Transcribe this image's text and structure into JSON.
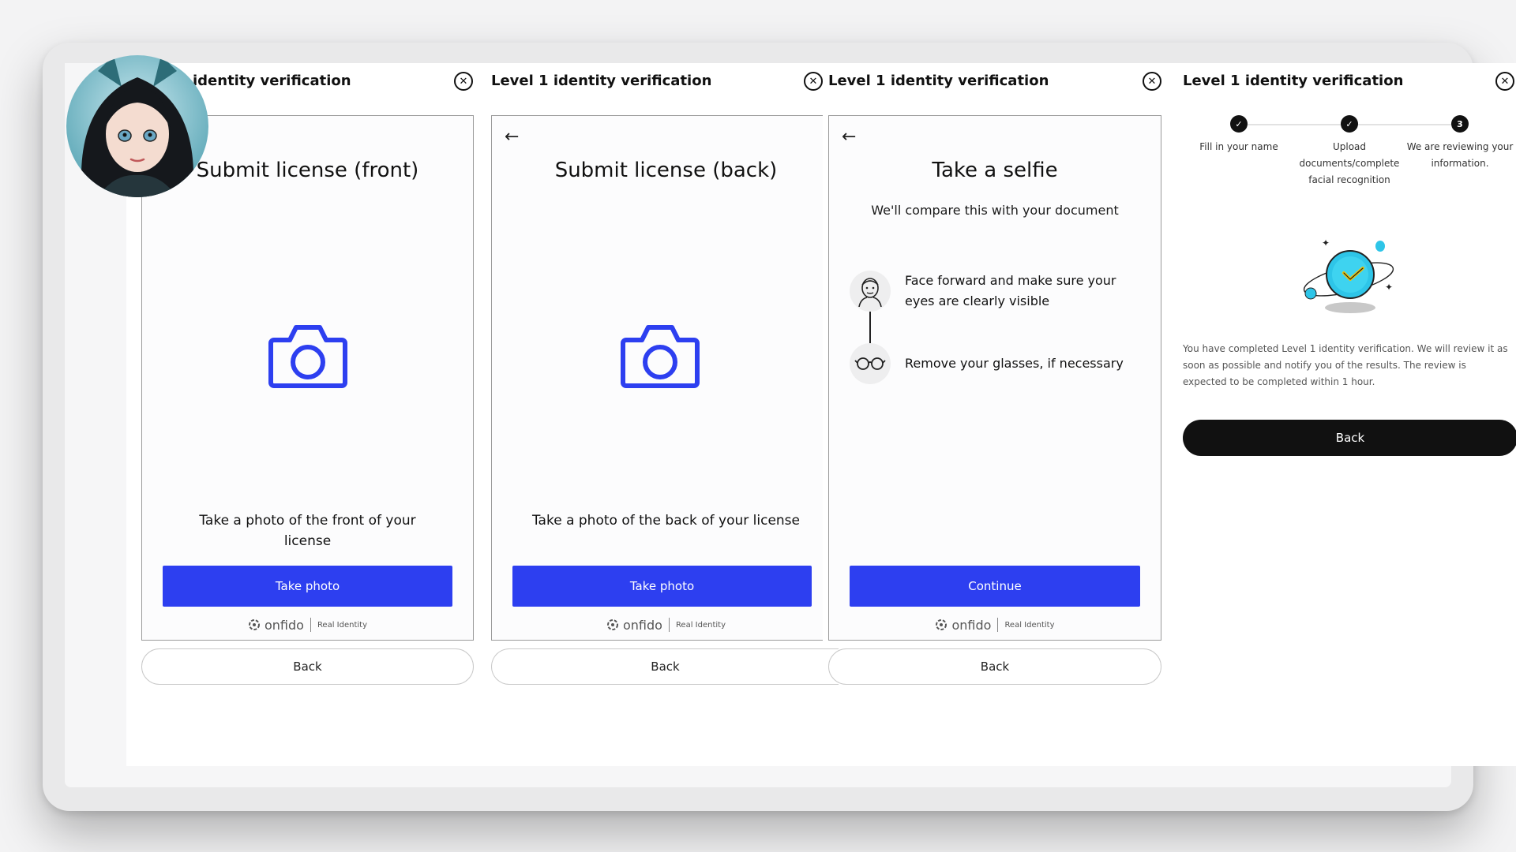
{
  "panels": [
    {
      "title": "Level 1 identity verification",
      "heading": "Submit license (front)",
      "instructions": "Take a photo of the front of your license",
      "primary_label": "Take photo",
      "back_label": "Back"
    },
    {
      "title": "Level 1 identity verification",
      "heading": "Submit license (back)",
      "instructions": "Take a photo of the back of your license",
      "primary_label": "Take photo",
      "back_label": "Back"
    },
    {
      "title": "Level 1 identity verification",
      "heading": "Take a selfie",
      "subheading": "We'll compare this with your document",
      "tips": [
        "Face forward and make sure your eyes are clearly visible",
        "Remove your glasses, if necessary"
      ],
      "primary_label": "Continue",
      "back_label": "Back"
    },
    {
      "title": "Level 1 identity verification",
      "steps": [
        {
          "label": "Fill in your name",
          "marker": "✓"
        },
        {
          "label": "Upload documents/complete facial recognition",
          "marker": "✓"
        },
        {
          "label": "We are reviewing your information.",
          "marker": "3"
        }
      ],
      "message": "You have completed Level 1 identity verification. We will review it as soon as possible and notify you of the results. The review is expected to be completed within 1 hour.",
      "back_label": "Back"
    }
  ],
  "partial_title": "identity verification",
  "branding": {
    "logo_text": "onfido",
    "tagline": "Real Identity"
  },
  "colors": {
    "primary": "#2d3ff0",
    "dark": "#111111",
    "accent": "#2ec5e8"
  },
  "icons": {
    "close": "close-circle-icon",
    "back": "arrow-left-icon",
    "camera": "camera-icon",
    "face": "face-icon",
    "glasses": "glasses-icon"
  }
}
